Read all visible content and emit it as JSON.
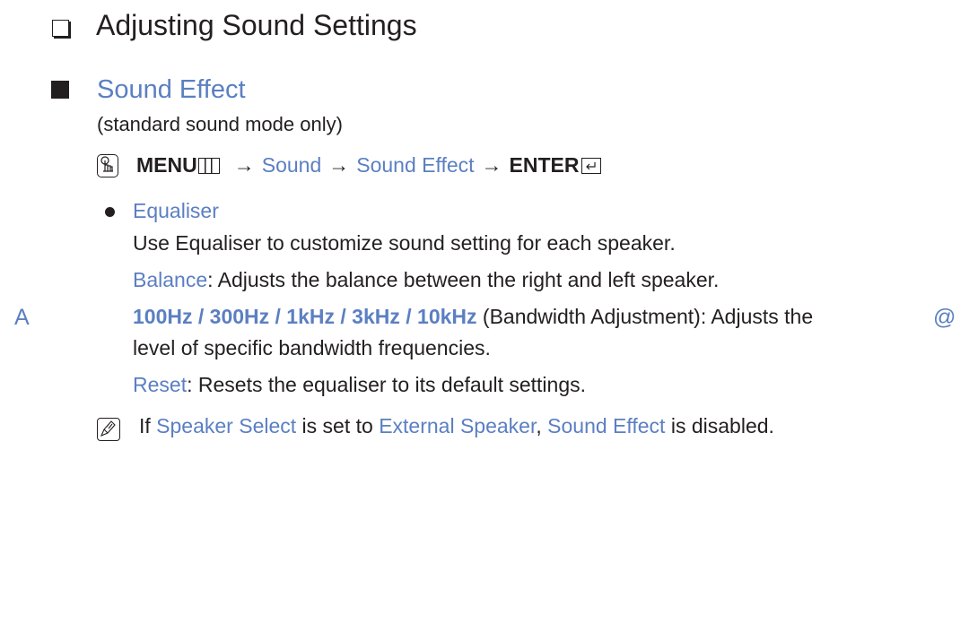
{
  "heading": {
    "title": "Adjusting Sound Settings",
    "icon": "hollow-square-icon"
  },
  "section": {
    "title": "Sound Effect",
    "icon": "filled-square-icon",
    "subtitle": "(standard sound mode only)"
  },
  "menu_path": {
    "icon": "remote-hand-icon",
    "items": [
      {
        "label": "MENU",
        "style": "bold",
        "icon": "menu-grid-icon"
      },
      {
        "label": "Sound",
        "style": "link"
      },
      {
        "label": "Sound Effect",
        "style": "link"
      },
      {
        "label": "ENTER",
        "style": "bold",
        "icon": "enter-icon"
      }
    ],
    "separator": "→"
  },
  "bullet": {
    "label": "Equaliser",
    "description": "Use Equaliser to customize sound setting for each speaker.",
    "options": [
      {
        "term": "Balance",
        "text": ": Adjusts the balance between the right and left speaker."
      },
      {
        "term": "100Hz / 300Hz / 1kHz / 3kHz / 10kHz",
        "text": " (Bandwidth Adjustment): Adjusts the",
        "continuation": "level of specific bandwidth frequencies."
      },
      {
        "term": "Reset",
        "text": ": Resets the equaliser to its default settings."
      }
    ]
  },
  "margin_markers": {
    "left": "A",
    "right": "@"
  },
  "note": {
    "icon": "note-pencil-icon",
    "prefix": "If ",
    "term1": "Speaker Select",
    "mid1": " is set to ",
    "term2": "External Speaker",
    "mid2": ", ",
    "term3": "Sound Effect",
    "suffix": " is disabled."
  },
  "colors": {
    "accent": "#5b7fc2",
    "text": "#231f20"
  }
}
